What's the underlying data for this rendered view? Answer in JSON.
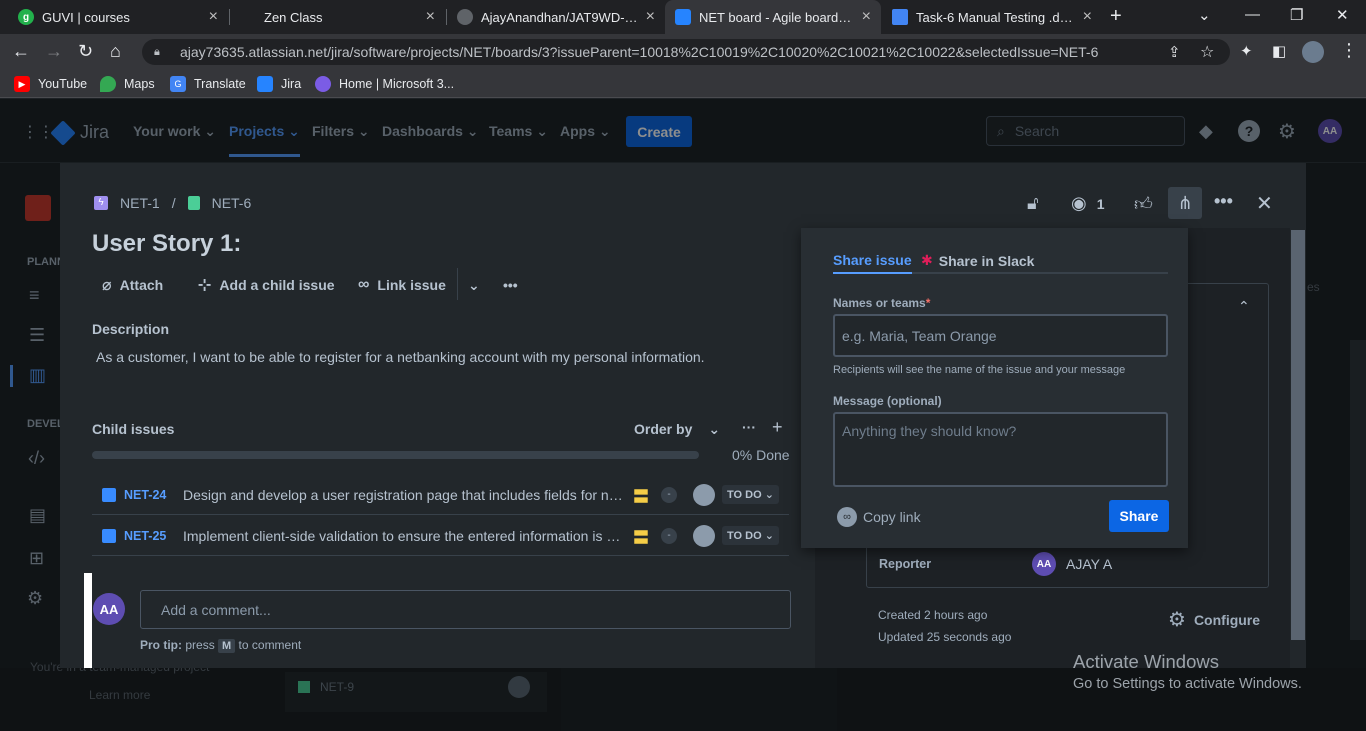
{
  "browser": {
    "tabs": [
      {
        "title": "GUVI | courses",
        "icon": "guvi-icon",
        "color": "#22b14c"
      },
      {
        "title": "Zen Class",
        "icon": "zen-icon",
        "color": "#202124"
      },
      {
        "title": "AjayAnandhan/JAT9WD-Day-",
        "icon": "github-icon",
        "color": "#5f6368"
      },
      {
        "title": "NET board - Agile board - Jir",
        "icon": "jira-icon",
        "color": "#2684ff"
      },
      {
        "title": "Task-6 Manual Testing .docx",
        "icon": "docs-icon",
        "color": "#4285f4"
      }
    ],
    "url": "ajay73635.atlassian.net/jira/software/projects/NET/boards/3?issueParent=10018%2C10019%2C10020%2C10021%2C10022&selectedIssue=NET-6",
    "bookmarks": [
      {
        "label": "YouTube",
        "icon": "youtube-icon",
        "color": "#ff0000"
      },
      {
        "label": "Maps",
        "icon": "maps-icon",
        "color": "#34a853"
      },
      {
        "label": "Translate",
        "icon": "translate-icon",
        "color": "#4285f4"
      },
      {
        "label": "Jira",
        "icon": "jira-icon",
        "color": "#2684ff"
      },
      {
        "label": "Home | Microsoft 3...",
        "icon": "microsoft-icon",
        "color": "#7b5ce5"
      }
    ]
  },
  "jira": {
    "logo": "Jira",
    "nav": [
      "Your work",
      "Projects",
      "Filters",
      "Dashboards",
      "Teams",
      "Apps"
    ],
    "create": "Create",
    "search_placeholder": "Search",
    "user_initials": "AA",
    "sidebar_sections": [
      "PLANN",
      "DEVEL"
    ],
    "bg_footer_text": "You're in a team-managed project",
    "bg_learn_more": "Learn more",
    "bg_card_key": "NET-9",
    "bg_side_text": "es"
  },
  "issue": {
    "parent_key": "NET-1",
    "key": "NET-6",
    "watchers": "1",
    "title": "User Story 1:",
    "actions": {
      "attach": "Attach",
      "add_child": "Add a child issue",
      "link": "Link issue"
    },
    "description_label": "Description",
    "description": "As a customer, I want to be able to register for a netbanking account with my personal information.",
    "child_label": "Child issues",
    "order_by": "Order by",
    "progress_percent": 0,
    "done_text": "0% Done",
    "children": [
      {
        "key": "NET-24",
        "summary": "Design and develop a user registration page that includes fields for name, email",
        "estimate": "-",
        "status": "TO DO"
      },
      {
        "key": "NET-25",
        "summary": "Implement client-side validation to ensure the entered information is valid",
        "estimate": "-",
        "status": "TO DO"
      }
    ],
    "comment_initials": "AA",
    "comment_placeholder": "Add a comment...",
    "protip_prefix": "Pro tip:",
    "protip_press": "press",
    "protip_key": "M",
    "protip_suffix": "to comment",
    "reporter_label": "Reporter",
    "reporter_initials": "AA",
    "reporter_name": "AJAY A",
    "created": "Created 2 hours ago",
    "updated": "Updated 25 seconds ago",
    "configure": "Configure"
  },
  "share": {
    "tab_issue": "Share issue",
    "tab_slack": "Share in Slack",
    "names_label": "Names or teams",
    "names_required": "*",
    "names_placeholder": "e.g. Maria, Team Orange",
    "names_hint": "Recipients will see the name of the issue and your message",
    "message_label": "Message (optional)",
    "message_placeholder": "Anything they should know?",
    "copy_link": "Copy link",
    "share_button": "Share"
  },
  "windows": {
    "activate_title": "Activate Windows",
    "activate_sub": "Go to Settings to activate Windows."
  }
}
